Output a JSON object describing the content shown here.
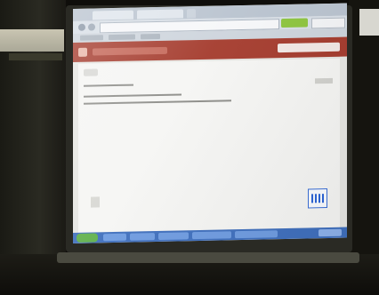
{
  "scene": {
    "subject": "",
    "colors": {
      "app_header": "#a43a2c",
      "taskbar": "#3f6fbd",
      "start_button": "#5fb04a",
      "go_button": "#8cc43c",
      "page_background": "#f5f5f3"
    },
    "icons": [
      "back-icon",
      "forward-icon",
      "app-logo-icon",
      "document-icon",
      "qr-badge-icon",
      "start-icon"
    ]
  }
}
